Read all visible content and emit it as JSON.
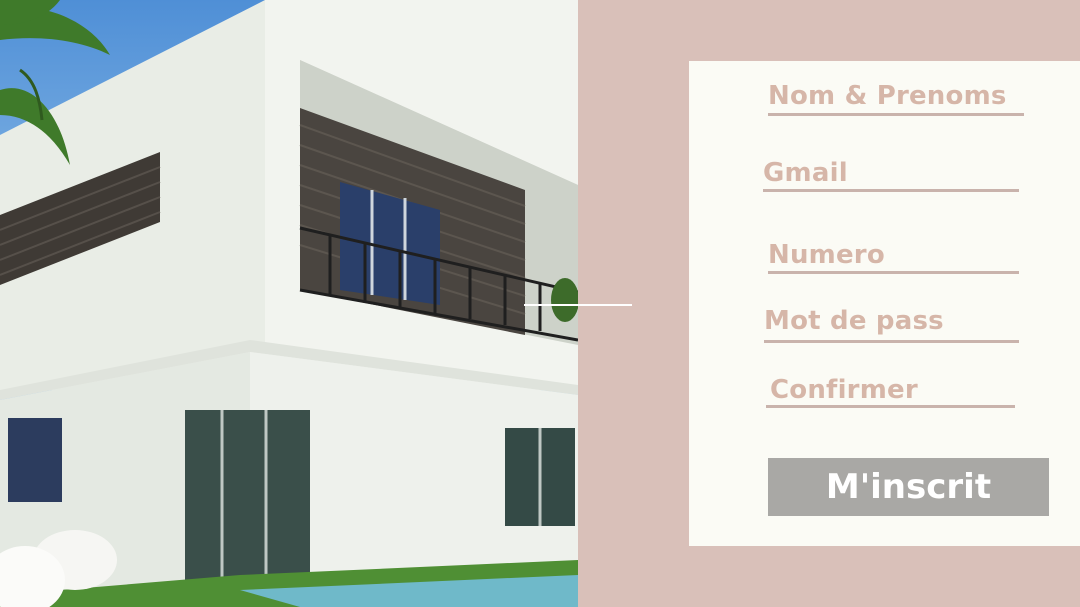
{
  "form": {
    "fields": [
      {
        "label": "Nom & Prenoms"
      },
      {
        "label": "Gmail"
      },
      {
        "label": "Numero"
      },
      {
        "label": "Mot de pass"
      },
      {
        "label": "Confirmer"
      }
    ],
    "submit_label": "M'inscrit"
  },
  "colors": {
    "background": "#d9c0b9",
    "card": "#fbfbf5",
    "label": "#d6b6a8",
    "underline": "#c9b3ac",
    "button": "#a9a8a5",
    "button_text": "#ffffff"
  }
}
